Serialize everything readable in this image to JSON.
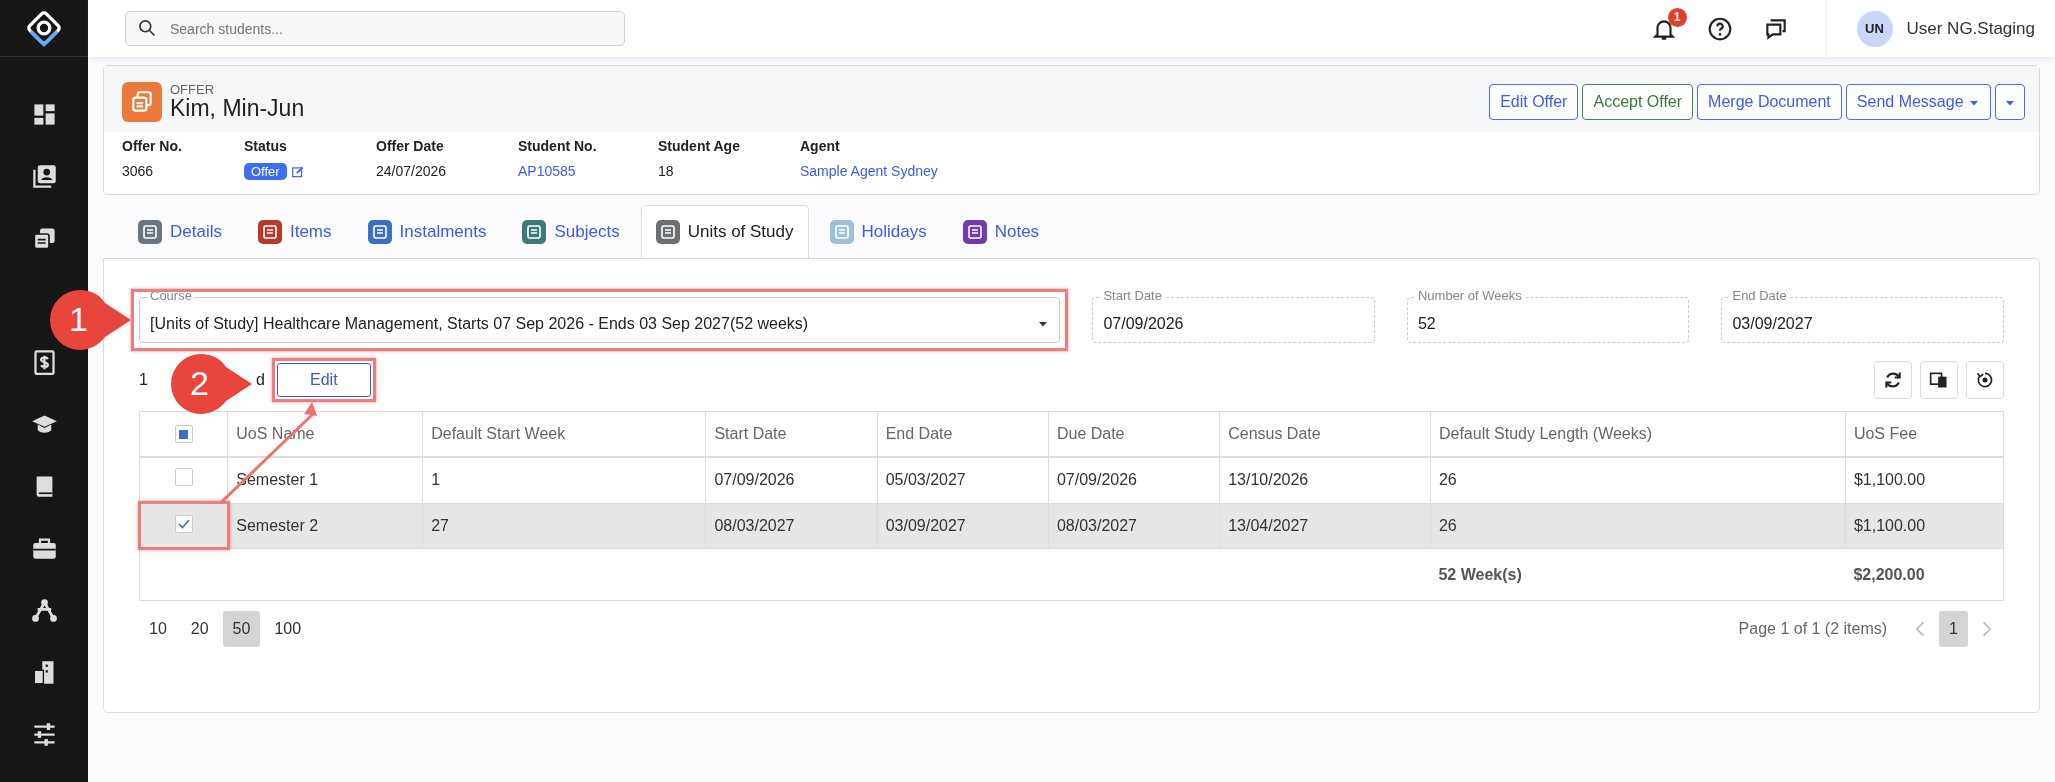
{
  "header": {
    "search": {
      "placeholder": "Search students..."
    },
    "notifications": {
      "count": "1"
    },
    "user": {
      "initials": "UN",
      "name": "User NG.Staging"
    }
  },
  "offer": {
    "kicker": "OFFER",
    "name": "Kim, Min-Jun",
    "actions": [
      {
        "label": "Edit Offer",
        "kind": "primary"
      },
      {
        "label": "Accept Offer",
        "kind": "success"
      },
      {
        "label": "Merge Document",
        "kind": "primary"
      },
      {
        "label": "Send Message",
        "kind": "dropdown"
      },
      {
        "kind": "caret"
      }
    ],
    "fields": [
      {
        "label": "Offer No.",
        "value": "3066",
        "kind": "text"
      },
      {
        "label": "Status",
        "value": "Offer",
        "kind": "badge"
      },
      {
        "label": "Offer Date",
        "value": "24/07/2026",
        "kind": "text"
      },
      {
        "label": "Student No.",
        "value": "AP10585",
        "kind": "link"
      },
      {
        "label": "Student Age",
        "value": "18",
        "kind": "text"
      },
      {
        "label": "Agent",
        "value": "Sample Agent Sydney",
        "kind": "link"
      }
    ]
  },
  "tabs": [
    {
      "label": "Details",
      "selected": false,
      "color": "#6c757d"
    },
    {
      "label": "Items",
      "selected": false,
      "color": "#b83a2a"
    },
    {
      "label": "Instalments",
      "selected": false,
      "color": "#3a6fc4"
    },
    {
      "label": "Subjects",
      "selected": false,
      "color": "#3f7a78"
    },
    {
      "label": "Units of Study",
      "selected": true,
      "color": "#6c7075"
    },
    {
      "label": "Holidays",
      "selected": false,
      "color": "#9dbfdc"
    },
    {
      "label": "Notes",
      "selected": false,
      "color": "#6f3cb0"
    }
  ],
  "course": {
    "label": "Course",
    "value": "[Units of Study] Healthcare Management, Starts 07 Sep 2026 - Ends 03 Sep 2027(52 weeks)"
  },
  "info_fields": [
    {
      "label": "Start Date",
      "value": "07/09/2026"
    },
    {
      "label": "Number of Weeks",
      "value": "52"
    },
    {
      "label": "End Date",
      "value": "03/09/2027"
    }
  ],
  "selection": {
    "count_text": "1",
    "tail_text": "d",
    "edit_button": "Edit"
  },
  "table": {
    "select_all_indeterminate": true,
    "columns": [
      "UoS Name",
      "Default Start Week",
      "Start Date",
      "End Date",
      "Due Date",
      "Census Date",
      "Default Study Length (Weeks)",
      "UoS Fee"
    ],
    "rows": [
      {
        "selected": false,
        "cells": [
          "Semester 1",
          "1",
          "07/09/2026",
          "05/03/2027",
          "07/09/2026",
          "13/10/2026",
          "26",
          "$1,100.00"
        ]
      },
      {
        "selected": true,
        "cells": [
          "Semester 2",
          "27",
          "08/03/2027",
          "03/09/2027",
          "08/03/2027",
          "13/04/2027",
          "26",
          "$1,100.00"
        ]
      }
    ],
    "totals": {
      "study_length": "52 Week(s)",
      "fee": "$2,200.00"
    }
  },
  "pager": {
    "sizes": [
      {
        "label": "10",
        "selected": false
      },
      {
        "label": "20",
        "selected": false
      },
      {
        "label": "50",
        "selected": true
      },
      {
        "label": "100",
        "selected": false
      }
    ],
    "info": "Page 1 of 1 (2 items)",
    "pages": [
      {
        "label": "1",
        "selected": true
      }
    ]
  },
  "annotations": [
    {
      "number": "1"
    },
    {
      "number": "2"
    }
  ]
}
